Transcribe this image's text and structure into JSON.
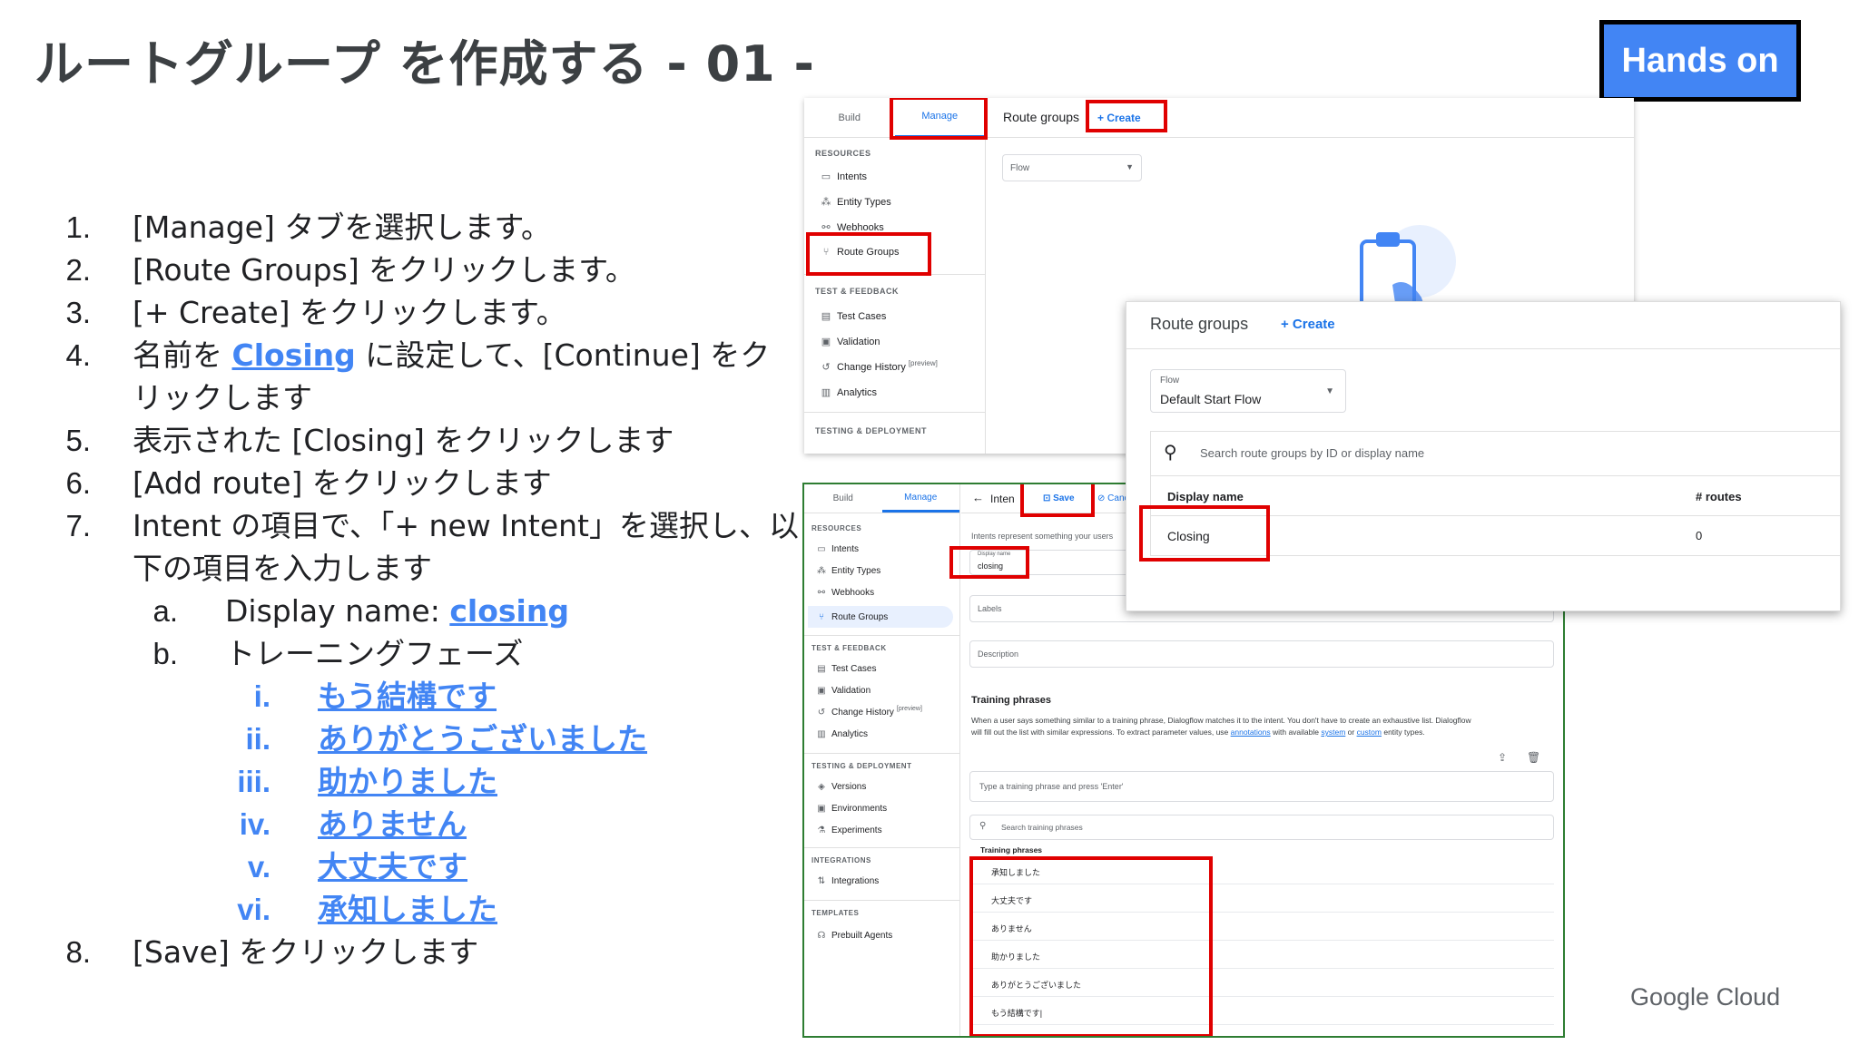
{
  "title": "ルートグループ を作成する - 01 -",
  "badge": "Hands on",
  "steps": [
    {
      "num": "1.",
      "text": "[Manage] タブを選択します。"
    },
    {
      "num": "2.",
      "text": "[Route Groups] をクリックします。"
    },
    {
      "num": "3.",
      "text": "[+ Create] をクリックします。"
    },
    {
      "num": "4.",
      "pre": "名前を ",
      "link": "Closing",
      "post": " に設定して、[Continue] をク",
      "cont": "リックします"
    },
    {
      "num": "5.",
      "text": "表示された [Closing] をクリックします"
    },
    {
      "num": "6.",
      "text": "[Add route] をクリックします"
    },
    {
      "num": "7.",
      "text": "Intent の項目で、「+ new Intent」を選択し、以",
      "cont": "下の項目を入力します"
    },
    {
      "num": "8.",
      "text": "[Save] をクリックします"
    }
  ],
  "substeps": [
    {
      "letter": "a.",
      "pre": "Display name: ",
      "link": "closing"
    },
    {
      "letter": "b.",
      "text": "トレーニングフェーズ"
    }
  ],
  "phrases": [
    {
      "num": "i.",
      "text": "もう結構です"
    },
    {
      "num": "ii.",
      "text": "ありがとうございました"
    },
    {
      "num": "iii.",
      "text": "助かりました"
    },
    {
      "num": "iv.",
      "text": "ありません"
    },
    {
      "num": "v.",
      "text": "大丈夫です"
    },
    {
      "num": "vi.",
      "text": "承知しました"
    }
  ],
  "shot1": {
    "tabs": {
      "build": "Build",
      "manage": "Manage"
    },
    "header_title": "Route groups",
    "create": "+ Create",
    "flow_select": "Flow",
    "sections": {
      "resources": "RESOURCES",
      "test": "TEST & FEEDBACK",
      "testing": "TESTING & DEPLOYMENT"
    },
    "items": {
      "intents": "Intents",
      "entity_types": "Entity Types",
      "webhooks": "Webhooks",
      "route_groups": "Route Groups",
      "test_cases": "Test Cases",
      "validation": "Validation",
      "change_history": "Change History",
      "preview": "[preview]",
      "analytics": "Analytics"
    }
  },
  "shot2": {
    "tabs": {
      "build": "Build",
      "manage": "Manage"
    },
    "header_title": "Inten",
    "save": "Save",
    "cancel": "Canc",
    "description_text": "Intents represent something your users",
    "display_name_label": "Display name",
    "display_name_value": "closing",
    "labels": "Labels",
    "description": "Description",
    "training_title": "Training phrases",
    "training_help_1": "When a user says something similar to a training phrase, Dialogflow matches it to the intent. You don't have to create an exhaustive list. Dialogflow",
    "training_help_2a": "will fill out the list with similar expressions. To extract parameter values, use ",
    "training_help_annotations": "annotations",
    "training_help_2b": " with available ",
    "training_help_system": "system",
    "training_help_or": " or ",
    "training_help_custom": "custom",
    "training_help_2c": " entity types.",
    "type_placeholder": "Type a training phrase and press 'Enter'",
    "search_placeholder": "Search training phrases",
    "list_header": "Training phrases",
    "phrases": [
      "承知しました",
      "大丈夫です",
      "ありません",
      "助かりました",
      "ありがとうございました",
      "もう結構です|"
    ],
    "sections": {
      "resources": "RESOURCES",
      "test": "TEST & FEEDBACK",
      "testing": "TESTING & DEPLOYMENT",
      "integrations": "INTEGRATIONS",
      "templates": "TEMPLATES"
    },
    "items": {
      "intents": "Intents",
      "entity_types": "Entity Types",
      "webhooks": "Webhooks",
      "route_groups": "Route Groups",
      "test_cases": "Test Cases",
      "validation": "Validation",
      "change_history": "Change History",
      "preview": "[preview]",
      "analytics": "Analytics",
      "versions": "Versions",
      "environments": "Environments",
      "experiments": "Experiments",
      "integrations": "Integrations",
      "prebuilt": "Prebuilt Agents"
    }
  },
  "shot3": {
    "title": "Route groups",
    "create": "+ Create",
    "flow_label": "Flow",
    "flow_value": "Default Start Flow",
    "search_placeholder": "Search route groups by ID or display name",
    "col_name": "Display name",
    "col_routes": "# routes",
    "row_name": "Closing",
    "row_routes": "0"
  },
  "footer": "Google Cloud",
  "colors": {
    "accent": "#4285f4",
    "highlight": "#e00000",
    "console_blue": "#1a73e8"
  }
}
